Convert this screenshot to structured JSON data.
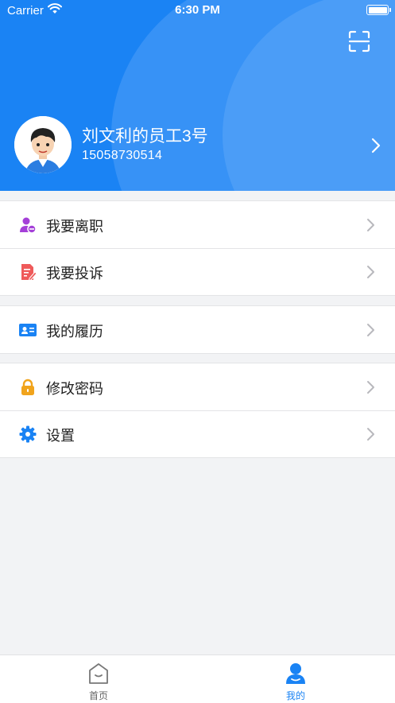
{
  "status_bar": {
    "carrier": "Carrier",
    "time": "6:30 PM"
  },
  "profile": {
    "name": "刘文利的员工3号",
    "phone": "15058730514"
  },
  "menu_groups": [
    [
      {
        "label": "我要离职",
        "icon": "user-minus-icon",
        "color": "#a43fd8"
      },
      {
        "label": "我要投诉",
        "icon": "edit-document-icon",
        "color": "#ef5a5a"
      }
    ],
    [
      {
        "label": "我的履历",
        "icon": "id-card-icon",
        "color": "#1a83f4"
      }
    ],
    [
      {
        "label": "修改密码",
        "icon": "lock-icon",
        "color": "#f1a41c"
      },
      {
        "label": "设置",
        "icon": "gear-icon",
        "color": "#1a83f4"
      }
    ]
  ],
  "tabbar": {
    "tabs": [
      {
        "label": "首页",
        "icon": "home-icon",
        "active": false
      },
      {
        "label": "我的",
        "icon": "profile-icon",
        "active": true
      }
    ],
    "active_color": "#1a83f4",
    "inactive_color": "#666666"
  }
}
